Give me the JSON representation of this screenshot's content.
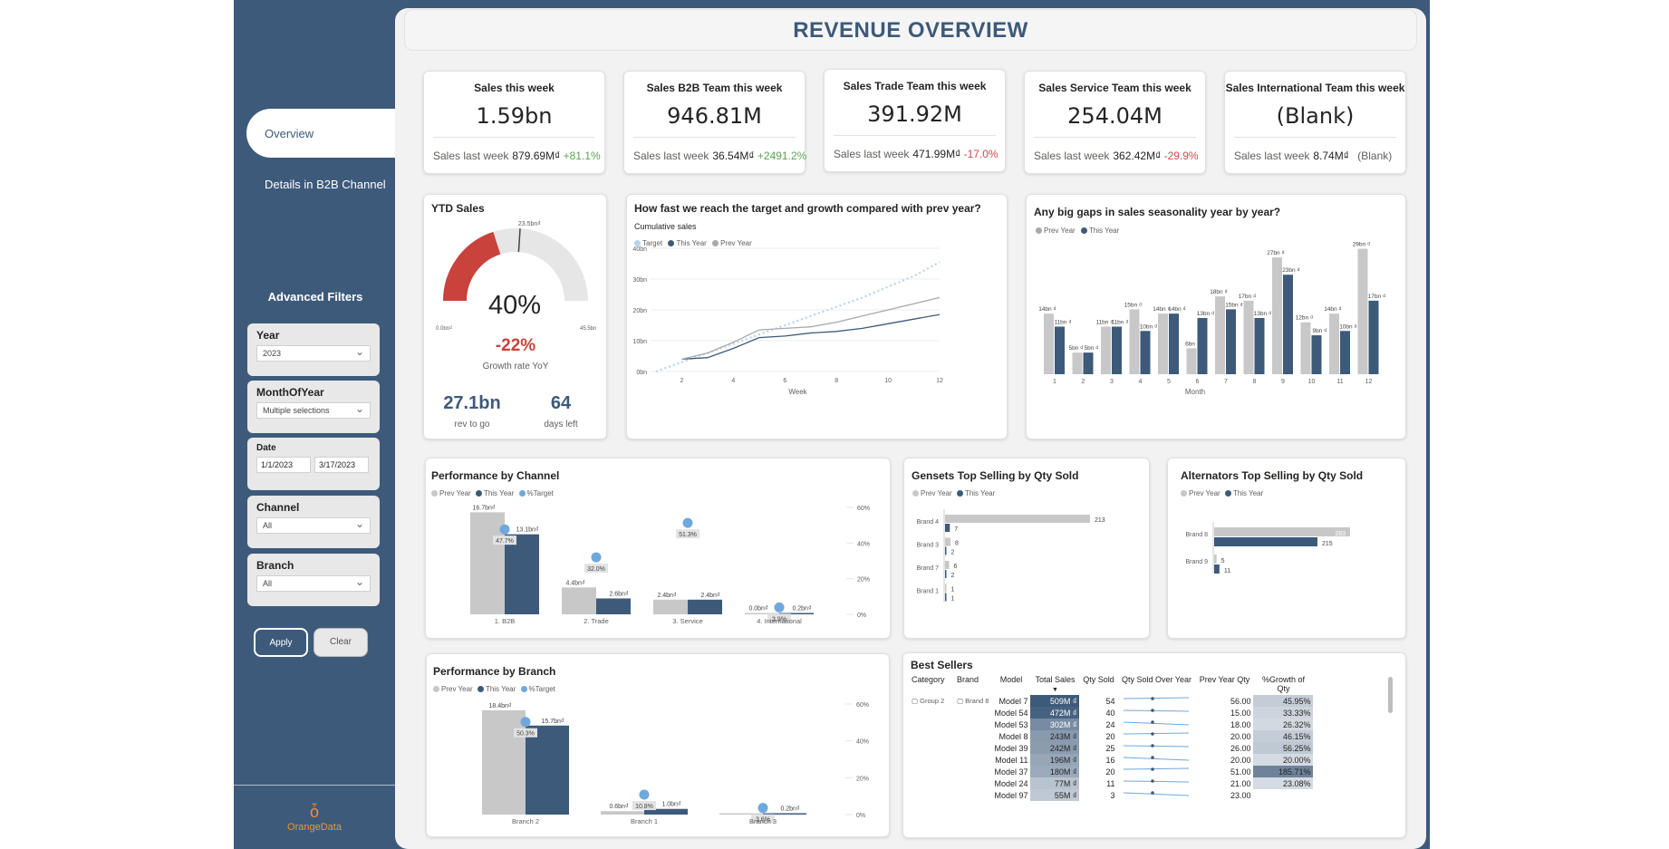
{
  "header": {
    "title": "REVENUE OVERVIEW"
  },
  "nav": {
    "overview": "Overview",
    "details": "Details in B2B Channel"
  },
  "filters": {
    "title": "Advanced Filters",
    "year": {
      "label": "Year",
      "value": "2023"
    },
    "month": {
      "label": "MonthOfYear",
      "value": "Multiple selections"
    },
    "date": {
      "label": "Date",
      "from": "1/1/2023",
      "to": "3/17/2023"
    },
    "channel": {
      "label": "Channel",
      "value": "All"
    },
    "branch": {
      "label": "Branch",
      "value": "All"
    },
    "apply": "Apply",
    "clear": "Clear"
  },
  "logo": {
    "text": "OrangeData"
  },
  "kpis": [
    {
      "title": "Sales this week",
      "value": "1.59bn",
      "last_label": "Sales last week",
      "last_value": "879.69M₫",
      "delta": "+81.1%",
      "delta_type": "pos"
    },
    {
      "title": "Sales B2B Team this week",
      "value": "946.81M",
      "last_label": "Sales last week",
      "last_value": "36.54M₫",
      "delta": "+2491.2%",
      "delta_type": "pos"
    },
    {
      "title": "Sales Trade Team this week",
      "value": "391.92M",
      "last_label": "Sales last week",
      "last_value": "471.99M₫",
      "delta": "-17.0%",
      "delta_type": "neg"
    },
    {
      "title": "Sales Service Team this week",
      "value": "254.04M",
      "last_label": "Sales last week",
      "last_value": "362.42M₫",
      "delta": "-29.9%",
      "delta_type": "neg"
    },
    {
      "title": "Sales International Team this week",
      "value": "(Blank)",
      "last_label": "Sales last week",
      "last_value": "8.74M₫",
      "delta": "(Blank)",
      "delta_type": "none"
    }
  ],
  "ytd": {
    "title": "YTD Sales",
    "percent": "40%",
    "gauge_fraction": 0.4,
    "min_label": "0.0bn₫",
    "max_label": "45.5bn",
    "target_label": "23.5bn₫",
    "target_fraction": 0.52,
    "growth": "-22%",
    "growth_label": "Growth rate YoY",
    "rev": "27.1bn",
    "rev_label": "rev to go",
    "days": "64",
    "days_label": "days left",
    "colors": {
      "fill": "#c9423c",
      "track": "#e6e6e6"
    }
  },
  "cumulative": {
    "title": "How fast we reach the target and growth compared with prev year?",
    "subtitle": "Cumulative sales",
    "legend": [
      "Target",
      "This Year",
      "Prev Year"
    ],
    "xlabel": "Week",
    "chart_data": {
      "type": "line",
      "x": [
        1,
        2,
        3,
        4,
        5,
        6,
        7,
        8,
        9,
        10,
        11,
        12
      ],
      "series": [
        {
          "name": "Target",
          "values": [
            0,
            3,
            6,
            9,
            12,
            15,
            18,
            21,
            24,
            27.5,
            31,
            35.5
          ]
        },
        {
          "name": "This Year",
          "values": [
            null,
            4,
            4.5,
            7.5,
            11,
            11.5,
            12.5,
            13,
            14,
            15.5,
            17,
            18.5
          ]
        },
        {
          "name": "Prev Year",
          "values": [
            null,
            4,
            6,
            9.5,
            13.5,
            14,
            14.5,
            16,
            18,
            20,
            22,
            24
          ]
        }
      ],
      "ylim": [
        0,
        40
      ],
      "yticks": [
        "0bn",
        "10bn",
        "20bn",
        "30bn",
        "40bn"
      ],
      "xticks": [
        2,
        4,
        6,
        8,
        10,
        12
      ]
    }
  },
  "seasonality": {
    "title": "Any big gaps in sales seasonality year by year?",
    "legend": [
      "Prev Year",
      "This Year"
    ],
    "xlabel": "Month",
    "chart_data": {
      "type": "bar",
      "categories": [
        "1",
        "2",
        "3",
        "4",
        "5",
        "6",
        "7",
        "8",
        "9",
        "10",
        "11",
        "12"
      ],
      "series": [
        {
          "name": "Prev Year",
          "values": [
            14,
            5,
            11,
            15,
            14,
            6,
            18,
            17,
            27,
            12,
            14,
            29
          ],
          "labels": [
            "14bn ₫",
            "5bn ₫",
            "11bn ₫",
            "15bn ₫",
            "14bn ₫",
            "6bn",
            "18bn ₫",
            "17bn ₫",
            "27bn ₫",
            "12bn ₫",
            "14bn ₫",
            "29bn ₫"
          ]
        },
        {
          "name": "This Year",
          "values": [
            11,
            5,
            11,
            10,
            14,
            13,
            15,
            13,
            23,
            9,
            10,
            17
          ],
          "labels": [
            "11bn ₫",
            "5bn ₫",
            "11bn ₫",
            "10bn ₫",
            "14bn ₫",
            "13bn ₫",
            "15bn ₫",
            "13bn ₫",
            "23bn ₫",
            "9bn ₫",
            "10bn ₫",
            "17bn ₫"
          ]
        }
      ],
      "ylim": [
        0,
        31
      ]
    }
  },
  "channel": {
    "title": "Performance by Channel",
    "legend": [
      "Prev Year",
      "This Year",
      "%Target"
    ],
    "chart_data": {
      "type": "bar",
      "categories": [
        "1. B2B",
        "2. Trade",
        "3. Service",
        "4. International"
      ],
      "series": [
        {
          "name": "Prev Year",
          "values": [
            16.7,
            4.4,
            2.4,
            0.0
          ],
          "labels": [
            "16.7bn₫",
            "4.4bn₫",
            "2.4bn₫",
            "0.0bn₫"
          ]
        },
        {
          "name": "This Year",
          "values": [
            13.1,
            2.6,
            2.4,
            0.2
          ],
          "labels": [
            "13.1bn₫",
            "2.6bn₫",
            "2.4bn₫",
            "0.2bn₫"
          ]
        },
        {
          "name": "%Target",
          "values": [
            47.7,
            32.0,
            51.3,
            3.9
          ],
          "labels": [
            "47.7%",
            "32.0%",
            "51.3%",
            "3.9%"
          ]
        }
      ],
      "ylim": [
        0,
        17.5
      ],
      "y2ticks": [
        "0%",
        "20%",
        "40%",
        "60%"
      ],
      "y2lim": [
        0,
        60
      ]
    }
  },
  "branch": {
    "title": "Performance by Branch",
    "legend": [
      "Prev Year",
      "This Year",
      "%Target"
    ],
    "chart_data": {
      "type": "bar",
      "categories": [
        "Branch 2",
        "Branch 1",
        "Branch 3"
      ],
      "series": [
        {
          "name": "Prev Year",
          "values": [
            18.4,
            0.6,
            0.0
          ],
          "labels": [
            "18.4bn₫",
            "0.6bn₫",
            ""
          ]
        },
        {
          "name": "This Year",
          "values": [
            15.7,
            1.0,
            0.2
          ],
          "labels": [
            "15.7bn₫",
            "1.0bn₫",
            "0.2bn₫"
          ]
        },
        {
          "name": "%Target",
          "values": [
            50.3,
            10.8,
            3.6
          ],
          "labels": [
            "50.3%",
            "10.8%",
            "3.6%"
          ]
        }
      ],
      "ylim": [
        0,
        19.5
      ],
      "y2ticks": [
        "0%",
        "20%",
        "40%",
        "60%"
      ],
      "y2lim": [
        0,
        60
      ]
    }
  },
  "gensets": {
    "title": "Gensets Top Selling by Qty Sold",
    "legend": [
      "Prev Year",
      "This Year"
    ],
    "chart_data": {
      "type": "bar",
      "categories": [
        "Brand 4",
        "Brand 3",
        "Brand 7",
        "Brand 1"
      ],
      "series": [
        {
          "name": "Prev Year",
          "values": [
            213,
            8,
            6,
            1
          ]
        },
        {
          "name": "This Year",
          "values": [
            7,
            2,
            2,
            1
          ]
        }
      ],
      "xlim": [
        0,
        213
      ]
    }
  },
  "alternators": {
    "title": "Alternators Top Selling by Qty Sold",
    "legend": [
      "Prev Year",
      "This Year"
    ],
    "chart_data": {
      "type": "bar",
      "categories": [
        "Brand 8",
        "Brand 9"
      ],
      "series": [
        {
          "name": "Prev Year",
          "values": [
            283,
            5
          ]
        },
        {
          "name": "This Year",
          "values": [
            215,
            11
          ]
        }
      ],
      "xlim": [
        0,
        283
      ]
    }
  },
  "bestsellers": {
    "title": "Best Sellers",
    "columns": [
      "Category",
      "Brand",
      "Model",
      "Total Sales",
      "Qty Sold",
      "Qty Sold Over Year",
      "Prev Year Qty",
      "%Growth of Qty"
    ],
    "group": "Group 2",
    "brand": "Brand 8",
    "rows": [
      {
        "model": "Model 7",
        "sales": "509M ₫",
        "sales_frac": 1.0,
        "qty": "54",
        "prev": "56.00",
        "growth": "45.95%",
        "growth_frac": 0.25
      },
      {
        "model": "Model 54",
        "sales": "472M ₫",
        "sales_frac": 0.93,
        "qty": "40",
        "prev": "15.00",
        "growth": "33.33%",
        "growth_frac": 0.18
      },
      {
        "model": "Model 53",
        "sales": "302M ₫",
        "sales_frac": 0.6,
        "qty": "24",
        "prev": "18.00",
        "growth": "26.32%",
        "growth_frac": 0.14
      },
      {
        "model": "Model 8",
        "sales": "243M ₫",
        "sales_frac": 0.48,
        "qty": "20",
        "prev": "20.00",
        "growth": "46.15%",
        "growth_frac": 0.25
      },
      {
        "model": "Model 39",
        "sales": "242M ₫",
        "sales_frac": 0.47,
        "qty": "25",
        "prev": "26.00",
        "growth": "56.25%",
        "growth_frac": 0.3
      },
      {
        "model": "Model 11",
        "sales": "196M ₫",
        "sales_frac": 0.38,
        "qty": "16",
        "prev": "20.00",
        "growth": "20.00%",
        "growth_frac": 0.11
      },
      {
        "model": "Model 37",
        "sales": "180M ₫",
        "sales_frac": 0.35,
        "qty": "20",
        "prev": "51.00",
        "growth": "185.71%",
        "growth_frac": 1.0
      },
      {
        "model": "Model 24",
        "sales": "77M ₫",
        "sales_frac": 0.15,
        "qty": "11",
        "prev": "21.00",
        "growth": "23.08%",
        "growth_frac": 0.12
      },
      {
        "model": "Model 97",
        "sales": "55M ₫",
        "sales_frac": 0.11,
        "qty": "3",
        "prev": "23.00",
        "growth": "",
        "growth_frac": 0
      }
    ]
  },
  "colors": {
    "prev": "#c8c8c8",
    "this": "#3d5a7a",
    "target": "#6fa8dc",
    "target_line": "#b7d3ec",
    "prev_line": "#a9a9a9"
  }
}
